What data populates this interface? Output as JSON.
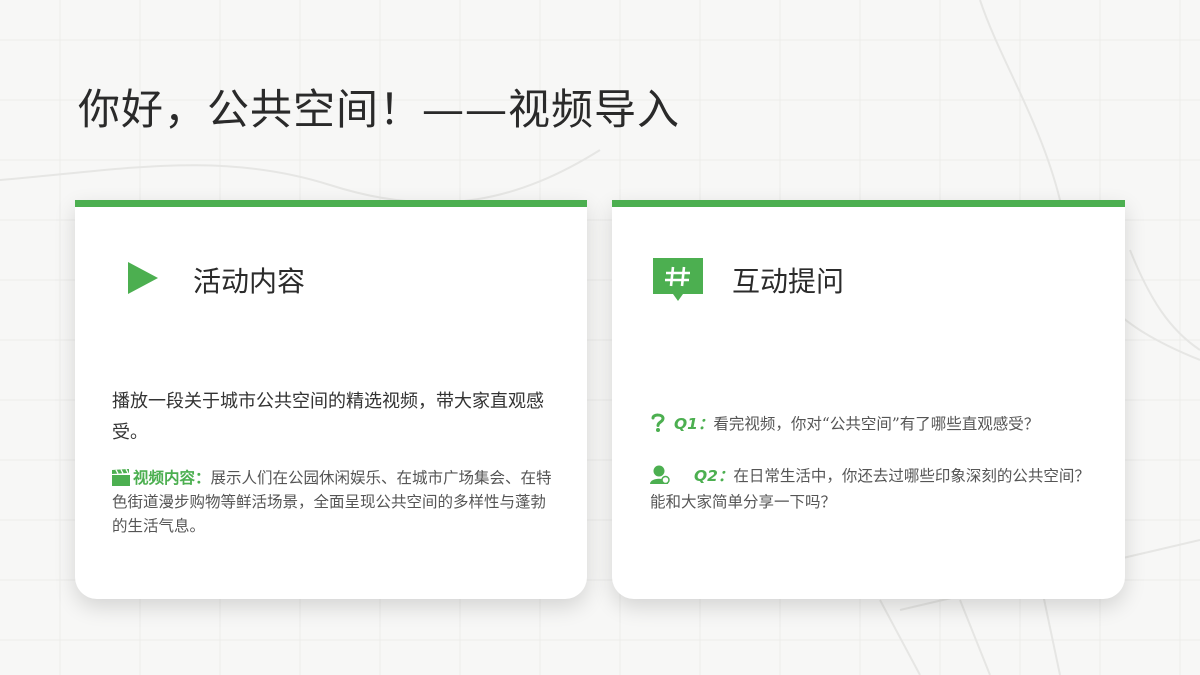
{
  "title": "你好，公共空间！——视频导入",
  "colors": {
    "accent": "#4caf50",
    "background": "#f7f7f6",
    "card": "#ffffff"
  },
  "activity": {
    "icon": "play-icon",
    "heading": "活动内容",
    "description": "播放一段关于城市公共空间的精选视频，带大家直观感受。",
    "detail_icon": "clapperboard-icon",
    "detail_label": "视频内容：",
    "detail_text": "展示人们在公园休闲娱乐、在城市广场集会、在特色街道漫步购物等鲜活场景，全面呈现公共空间的多样性与蓬勃的生活气息。"
  },
  "interaction": {
    "icon": "hashtag-chat-icon",
    "heading": "互动提问",
    "questions": [
      {
        "icon": "question-icon",
        "label": "Q1：",
        "text": "看完视频，你对“公共空间”有了哪些直观感受？"
      },
      {
        "icon": "user-icon",
        "label": "Q2：",
        "text": "在日常生活中，你还去过哪些印象深刻的公共空间？能和大家简单分享一下吗？"
      }
    ]
  }
}
